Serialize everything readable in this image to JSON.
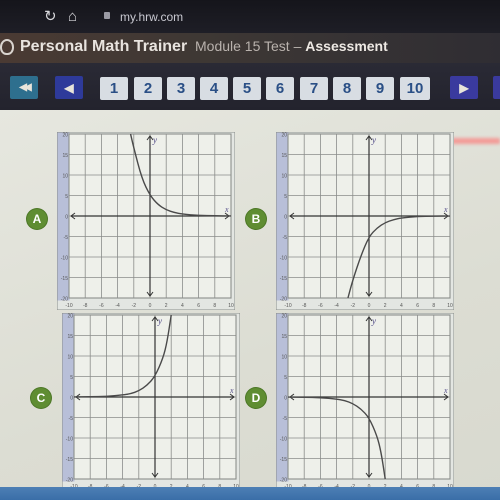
{
  "browser": {
    "url": "my.hrw.com",
    "icons": [
      "reload-icon",
      "home-icon",
      "lock-icon"
    ],
    "reload_glyph": "↻",
    "home_glyph": "⌂"
  },
  "header": {
    "app_title": "Personal Math Trainer",
    "module": "Module 15 Test",
    "separator": " – ",
    "section": "Assessment"
  },
  "navigation": {
    "first_glyph": "◀◀",
    "prev_glyph": "◀",
    "next_glyph": "▶",
    "questions": [
      "1",
      "2",
      "3",
      "4",
      "5",
      "6",
      "7",
      "8",
      "9",
      "10"
    ],
    "colors": {
      "first_button": "#2e6f8e",
      "prev_next_button": "#2e3a9a",
      "question_button": "#d8dde3",
      "question_text": "#2a4f86"
    }
  },
  "options": [
    {
      "label": "A",
      "description": "Decreasing exponential above x-axis: passes (0,5), approaches y=0 as x increases, rises steeply for negative x",
      "points": [
        [
          -2.4,
          20
        ],
        [
          -2,
          16.6
        ],
        [
          -1,
          9.1
        ],
        [
          0,
          5
        ],
        [
          1,
          2.75
        ],
        [
          2,
          1.5
        ],
        [
          3,
          0.83
        ],
        [
          4,
          0.46
        ],
        [
          6,
          0.14
        ],
        [
          8,
          0.04
        ],
        [
          10,
          0.01
        ]
      ]
    },
    {
      "label": "B",
      "description": "Reflection of decreasing exponential below x-axis: passes (0,-5), approaches y=0 as x increases",
      "points": [
        [
          -2.6,
          -20
        ],
        [
          -2,
          -15.6
        ],
        [
          -1,
          -9.7
        ],
        [
          0,
          -5
        ],
        [
          1,
          -2.9
        ],
        [
          2,
          -1.6
        ],
        [
          3,
          -0.9
        ],
        [
          4,
          -0.46
        ],
        [
          6,
          -0.12
        ],
        [
          8,
          -0.03
        ],
        [
          10,
          -0.01
        ]
      ]
    },
    {
      "label": "C",
      "description": "Increasing exponential above x-axis: approaches y=0 for negative x, passes (0,5), rises steeply",
      "points": [
        [
          -10,
          0.02
        ],
        [
          -8,
          0.05
        ],
        [
          -6,
          0.14
        ],
        [
          -4,
          0.5
        ],
        [
          -3,
          0.8
        ],
        [
          -2,
          1.5
        ],
        [
          -1,
          2.8
        ],
        [
          0,
          5
        ],
        [
          1,
          9.5
        ],
        [
          1.5,
          13.5
        ],
        [
          2,
          20
        ]
      ]
    },
    {
      "label": "D",
      "description": "Reflection of increasing exponential below x-axis: approaches y=0 for negative x, passes (0,-5), falls steeply",
      "points": [
        [
          -10,
          -0.02
        ],
        [
          -8,
          -0.05
        ],
        [
          -6,
          -0.15
        ],
        [
          -4,
          -0.5
        ],
        [
          -3,
          -0.85
        ],
        [
          -2,
          -1.6
        ],
        [
          -1,
          -2.9
        ],
        [
          0,
          -5
        ],
        [
          1,
          -9.5
        ],
        [
          1.5,
          -13.5
        ],
        [
          2,
          -20
        ]
      ]
    }
  ],
  "axes": {
    "x_label": "x",
    "y_label": "y",
    "x_range": [
      -10,
      10
    ],
    "y_range": [
      -20,
      20
    ],
    "x_ticks": [
      "-10",
      "-8",
      "-6",
      "-4",
      "-2",
      "0",
      "2",
      "4",
      "6",
      "8",
      "10"
    ],
    "y_ticks": [
      "20",
      "15",
      "10",
      "5",
      "0",
      "-5",
      "-10",
      "-15",
      "-20"
    ]
  },
  "colors": {
    "option_badge": "#5f8d32",
    "curve": "#4a4a4a",
    "grid": "#8a8d8a",
    "axis_panel": "#b8bfd8",
    "graph_bg": "#eef0ea"
  }
}
